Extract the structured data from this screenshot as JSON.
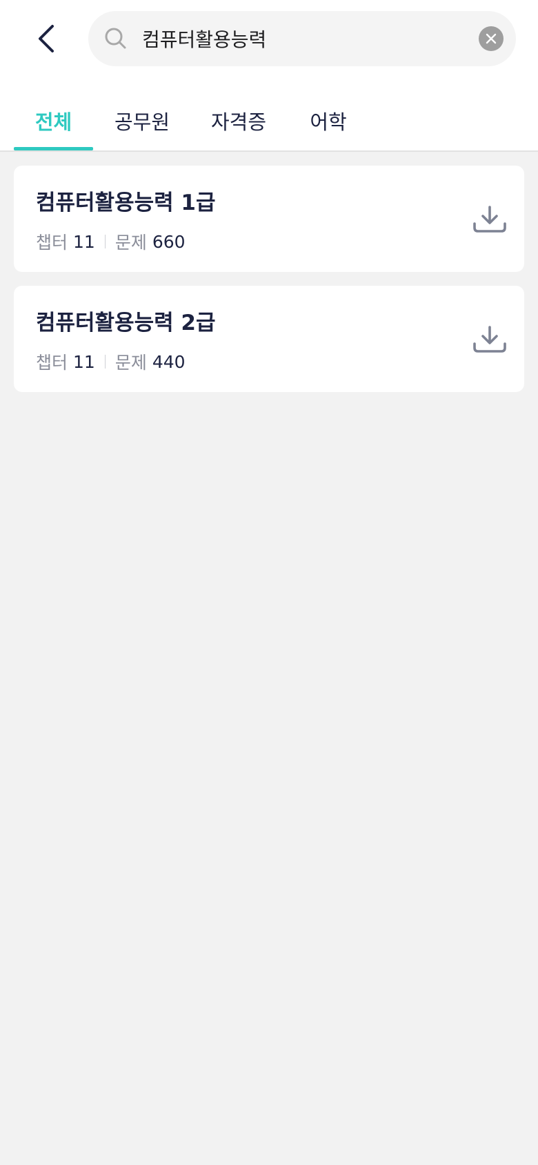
{
  "search": {
    "value": "컴퓨터활용능력",
    "placeholder": ""
  },
  "icons": {
    "back": "chevron-left-icon",
    "search": "search-icon",
    "clear": "close-icon",
    "download": "download-icon"
  },
  "colors": {
    "accent": "#2ec9c0",
    "text_primary": "#1c2240",
    "text_secondary": "#8a8d99",
    "background": "#f2f2f2"
  },
  "tabs": [
    {
      "label": "전체",
      "active": true
    },
    {
      "label": "공무원",
      "active": false
    },
    {
      "label": "자격증",
      "active": false
    },
    {
      "label": "어학",
      "active": false
    }
  ],
  "results": [
    {
      "title": "컴퓨터활용능력 1급",
      "chapter_label": "챕터",
      "chapter_count": "11",
      "question_label": "문제",
      "question_count": "660"
    },
    {
      "title": "컴퓨터활용능력 2급",
      "chapter_label": "챕터",
      "chapter_count": "11",
      "question_label": "문제",
      "question_count": "440"
    }
  ]
}
